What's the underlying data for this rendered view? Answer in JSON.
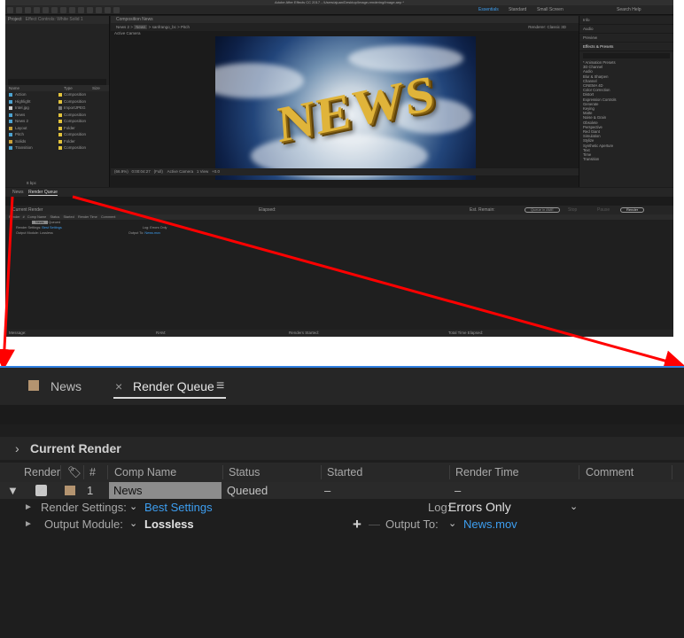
{
  "app": {
    "title_bar": "Adobe After Effects CC 2017 - /Users/ajuan/Desktop/Image-rendering/Image.aep *",
    "workspaces": [
      "Essentials",
      "Standard",
      "Small Screen"
    ],
    "search_help": "Search Help"
  },
  "project_panel": {
    "tab": "Project",
    "tab2": "Effect Controls: White Solid 1",
    "columns": [
      "Name",
      "Type",
      "Size"
    ],
    "items": [
      {
        "name": "Action",
        "type": "Composition"
      },
      {
        "name": "Highlight",
        "type": "Composition"
      },
      {
        "name": "Intel.jpg",
        "type": "ImportJPEG"
      },
      {
        "name": "News",
        "type": "Composition"
      },
      {
        "name": "News 2",
        "type": "Composition"
      },
      {
        "name": "Layout",
        "type": "Folder"
      },
      {
        "name": "Pitch",
        "type": "Composition"
      },
      {
        "name": "Solids",
        "type": "Folder"
      },
      {
        "name": "Transition",
        "type": "Composition"
      }
    ],
    "bpc": "8 bpc"
  },
  "composition_panel": {
    "tab": "Composition News",
    "breadcrumb": [
      "News 2",
      "News",
      "sanfrango_bc",
      "Pitch"
    ],
    "renderer": "Renderer: Classic 3D",
    "view_label": "Active Camera",
    "overlay_text": "NEWS",
    "zoom": "(66.9%)",
    "timecode": "0:00:04:27",
    "resolution": "(Full)",
    "camera": "Active Camera",
    "views": "1 View",
    "exposure": "+0.0"
  },
  "right_panel": {
    "sections": [
      "Info",
      "Audio",
      "Preview",
      "Effects & Presets"
    ],
    "effects": [
      "* Animation Presets",
      "3D Channel",
      "Audio",
      "Blur & Sharpen",
      "Channel",
      "CINEMA 4D",
      "Color Correction",
      "Distort",
      "Expression Controls",
      "Generate",
      "Keying",
      "Matte",
      "Noise & Grain",
      "Obsolete",
      "Perspective",
      "Red Giant",
      "Simulation",
      "Stylize",
      "Synthetic Aperture",
      "Text",
      "Time",
      "Transition"
    ]
  },
  "render_queue": {
    "tabs": {
      "news": "News",
      "close": "×",
      "render_queue": "Render Queue",
      "menu": "≡"
    },
    "current_render": {
      "chevron": "›",
      "label": "Current Render"
    },
    "thumb_labels": {
      "elapsed": "Elapsed:",
      "est_remain": "Est. Remain:",
      "queue_ame": "Queue in AME",
      "stop": "Stop",
      "pause": "Pause",
      "render": "Render"
    },
    "columns": {
      "render": "Render",
      "num": "#",
      "comp_name": "Comp Name",
      "status": "Status",
      "started": "Started",
      "render_time": "Render Time",
      "comment": "Comment"
    },
    "item": {
      "twirl": "▼",
      "checked": "✓",
      "number": "1",
      "comp_name": "News",
      "status": "Queued",
      "started": "–",
      "render_time": "–"
    },
    "render_settings": {
      "label": "Render Settings:",
      "value": "Best Settings",
      "log_label": "Log:",
      "log_value": "Errors Only"
    },
    "output_module": {
      "label": "Output Module:",
      "value": "Lossless",
      "plus": "+",
      "minus": "—",
      "output_to_label": "Output To:",
      "output_to_value": "News.mov"
    },
    "footer": {
      "message": "Message:",
      "ram": "RAM:",
      "renders_started": "Renders Started:",
      "total_time": "Total Time Elapsed:"
    }
  },
  "colors": {
    "accent_blue": "#3d9ef0",
    "label_tan": "#b49470",
    "arrow_red": "#ff0000",
    "panel_focus": "#2f7fe0"
  }
}
